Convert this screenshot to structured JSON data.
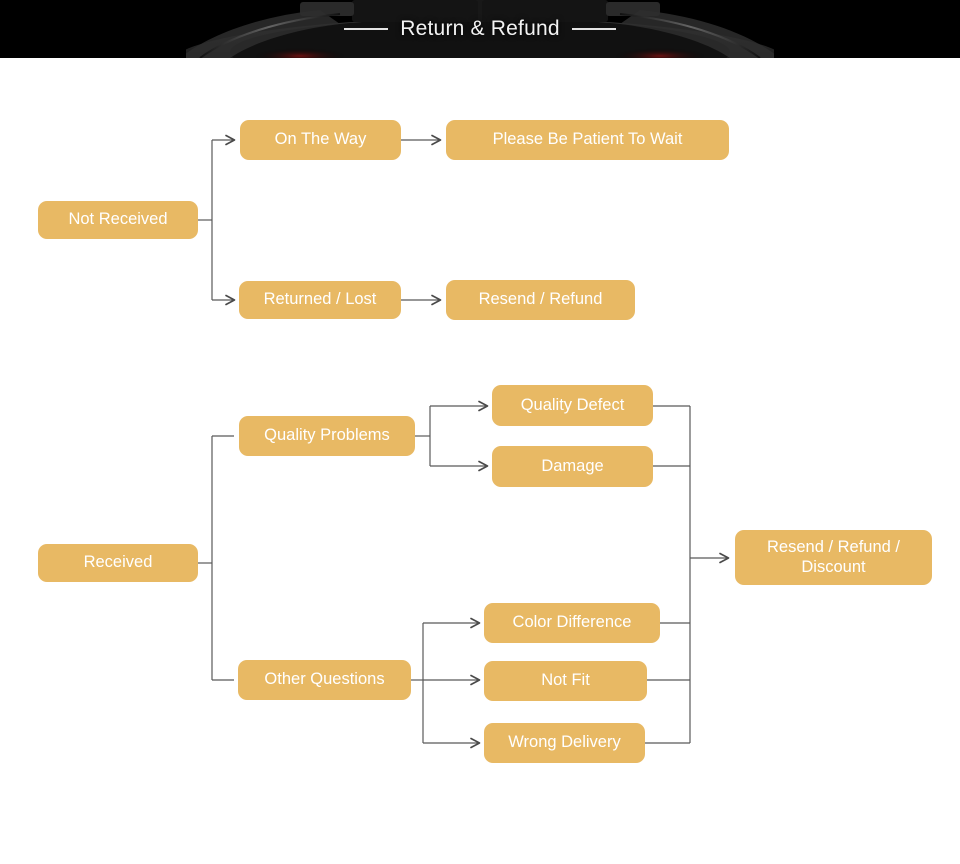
{
  "banner": {
    "title": "Return & Refund",
    "left_rule": "rule",
    "right_rule": "rule",
    "background_color": "#000000",
    "title_color": "#f2f2f2",
    "image_subject": "dark car rear photo"
  },
  "theme": {
    "node_fill": "#e8b964",
    "node_text": "#ffffff",
    "connector": "#555555",
    "page_background": "#ffffff"
  },
  "flow": {
    "branch_not_received": {
      "root": "Not Received",
      "steps": [
        {
          "cause": "On The Way",
          "result": "Please Be Patient To Wait"
        },
        {
          "cause": "Returned / Lost",
          "result": "Resend / Refund"
        }
      ]
    },
    "branch_received": {
      "root": "Received",
      "categories": [
        {
          "label": "Quality Problems",
          "issues": [
            "Quality Defect",
            "Damage"
          ]
        },
        {
          "label": "Other Questions",
          "issues": [
            "Color Difference",
            "Not Fit",
            "Wrong Delivery"
          ]
        }
      ],
      "outcome": "Resend / Refund /\nDiscount"
    }
  },
  "nodes": {
    "not_received": "Not Received",
    "on_the_way": "On The Way",
    "please_wait": "Please Be Patient To Wait",
    "returned_lost": "Returned / Lost",
    "resend_refund": "Resend / Refund",
    "received": "Received",
    "quality_problems": "Quality Problems",
    "quality_defect": "Quality Defect",
    "damage": "Damage",
    "other_questions": "Other Questions",
    "color_difference": "Color Difference",
    "not_fit": "Not Fit",
    "wrong_delivery": "Wrong Delivery",
    "resend_refund_discount": "Resend / Refund /\nDiscount"
  }
}
